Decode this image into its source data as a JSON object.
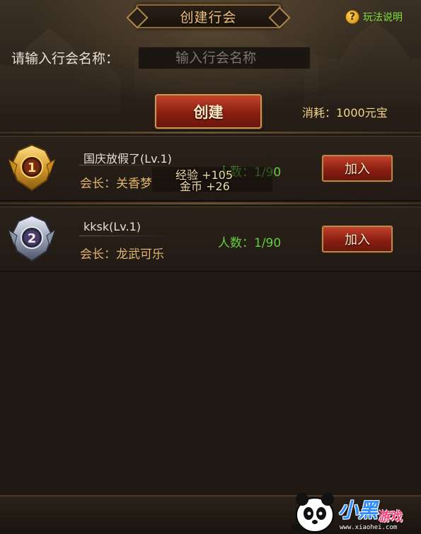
{
  "header": {
    "title": "创建行会",
    "help_label": "玩法说明",
    "help_icon": "question-icon"
  },
  "create_form": {
    "name_label": "请输入行会名称：",
    "name_placeholder": "输入行会名称",
    "name_value": "",
    "create_label": "创建",
    "cost_text": "消耗：1000元宝"
  },
  "guilds": [
    {
      "rank": "1",
      "rank_icon": "gold-rank-badge-icon",
      "name": "国庆放假了(Lv.1)",
      "leader": "会长：关香梦",
      "members": "人数：1/90",
      "join_label": "加入"
    },
    {
      "rank": "2",
      "rank_icon": "silver-rank-badge-icon",
      "name": "kksk(Lv.1)",
      "leader": "会长：龙武可乐",
      "members": "人数：1/90",
      "join_label": "加入"
    }
  ],
  "float_rewards": {
    "exp": "经验 +105",
    "gold": "金币 +26"
  },
  "watermark": {
    "brand": "小黑",
    "brand_sub": "游戏",
    "url": "www.xiaohei.com"
  },
  "colors": {
    "accent_gold": "#f2c27a",
    "members_green": "#5fd23a",
    "leader_orange": "#e2b56e",
    "button_red": "#8a1f12",
    "help_green": "#7ee23a"
  }
}
